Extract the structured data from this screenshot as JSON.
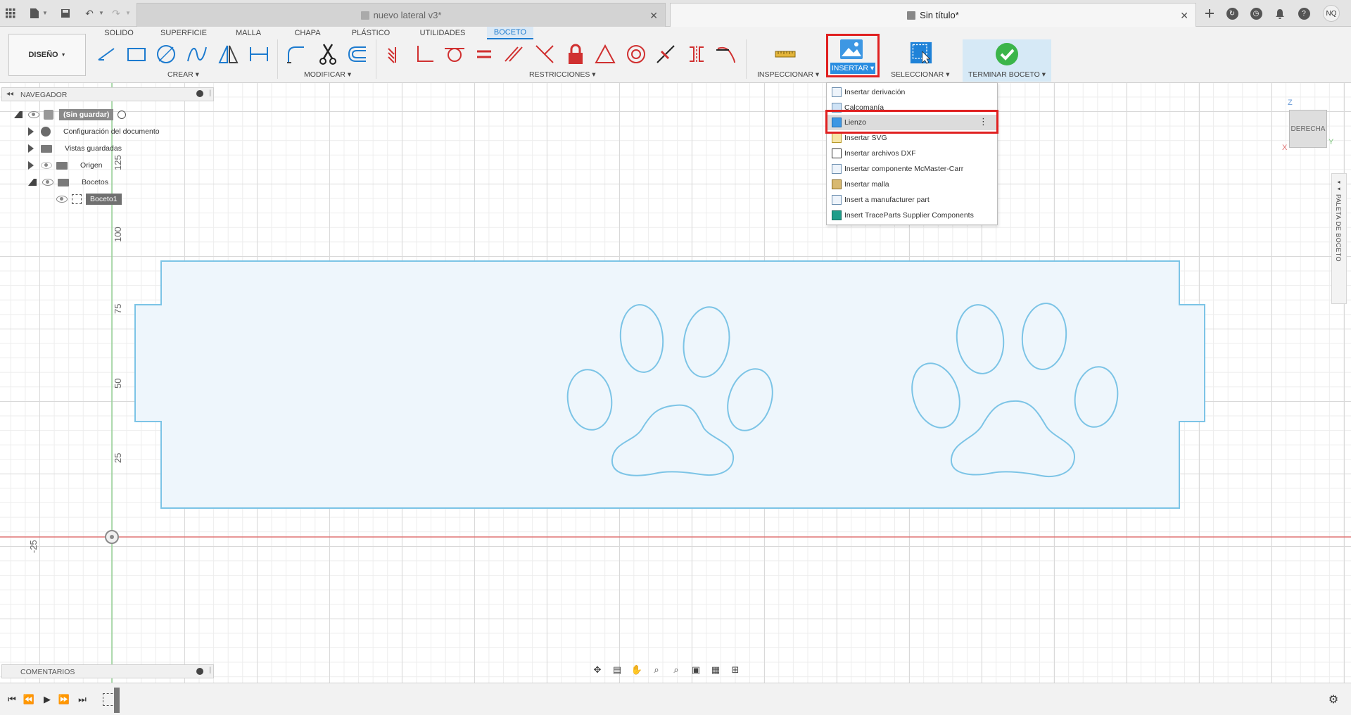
{
  "titlebar": {
    "inactive_tab": "nuevo lateral v3*",
    "active_tab": "Sin título*",
    "user_initials": "NQ"
  },
  "ribbon": {
    "workspace": "DISEÑO",
    "tabs": [
      "SOLIDO",
      "SUPERFICIE",
      "MALLA",
      "CHAPA",
      "PLÁSTICO",
      "UTILIDADES",
      "BOCETO"
    ],
    "active_tab": "BOCETO",
    "groups": {
      "create": "CREAR",
      "modify": "MODIFICAR",
      "constraints": "RESTRICCIONES",
      "inspect": "INSPECCIONAR",
      "insert": "INSERTAR",
      "select": "SELECCIONAR",
      "finish": "TERMINAR BOCETO"
    }
  },
  "insert_menu": {
    "items": [
      "Insertar derivación",
      "Calcomanía",
      "Lienzo",
      "Insertar SVG",
      "Insertar archivos DXF",
      "Insertar componente McMaster-Carr",
      "Insertar malla",
      "Insert a manufacturer part",
      "Insert TraceParts Supplier Components"
    ],
    "highlighted": "Lienzo"
  },
  "navigator": {
    "title": "NAVEGADOR",
    "root": "(Sin guardar)",
    "items": [
      "Configuración del documento",
      "Vistas guardadas",
      "Origen",
      "Bocetos"
    ],
    "sketch": "Boceto1"
  },
  "comments": {
    "title": "COMENTARIOS"
  },
  "viewcube": {
    "face": "DERECHA",
    "axis_z": "Z",
    "axis_y": "Y",
    "axis_x": "X"
  },
  "palette": {
    "label": "PALETA DE BOCETO"
  },
  "axis_labels": [
    "125",
    "100",
    "75",
    "50",
    "25",
    "-25"
  ],
  "colors": {
    "accent": "#1d7bcf",
    "highlight_box": "#e02020",
    "sketch_line": "#7cc4e6",
    "sketch_fill": "#eef6fc",
    "x_axis": "#e07070",
    "y_axis": "#8fd08f",
    "finish_check": "#3bb54a"
  }
}
